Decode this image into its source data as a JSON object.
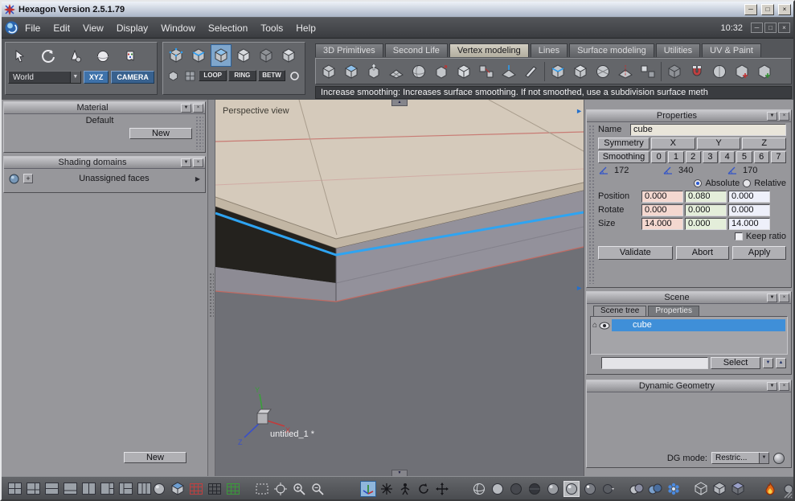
{
  "glyphs": {
    "collapse": "▼",
    "up": "▲",
    "down": "▼",
    "expand": "▶",
    "panel_arrow": "►",
    "close": "×",
    "minimize": "─",
    "maximize": "□",
    "plus": "+",
    "home": "⌂",
    "dropdown": "▼"
  },
  "window": {
    "title": "Hexagon Version 2.5.1.79",
    "clock": "10:32"
  },
  "menu": {
    "items": [
      "File",
      "Edit",
      "View",
      "Display",
      "Window",
      "Selection",
      "Tools",
      "Help"
    ]
  },
  "ribbon": {
    "tabs": [
      "3D Primitives",
      "Second Life",
      "Vertex modeling",
      "Lines",
      "Surface modeling",
      "Utilities",
      "UV & Paint"
    ],
    "active_tab": "Vertex modeling",
    "status": "Increase smoothing: Increases surface smoothing. If not smoothed, use a subdivision surface meth"
  },
  "toolbar": {
    "world": "World",
    "xyz": "XYZ",
    "camera": "CAMERA",
    "loop": "LOOP",
    "ring": "RING",
    "betw": "BETW"
  },
  "left": {
    "material": {
      "title": "Material",
      "item": "Default",
      "new_button": "New"
    },
    "shading": {
      "title": "Shading domains",
      "item": "Unassigned faces"
    },
    "new_button": "New"
  },
  "viewport": {
    "label": "Perspective view",
    "document": "untitled_1 *",
    "axis_x": "X",
    "axis_y": "Y",
    "axis_z": "Z"
  },
  "properties": {
    "title": "Properties",
    "name_label": "Name",
    "name_value": "cube",
    "symmetry": "Symmetry",
    "axes": [
      "X",
      "Y",
      "Z"
    ],
    "smoothing": "Smoothing",
    "levels": [
      "0",
      "1",
      "2",
      "3",
      "4",
      "5",
      "6",
      "7"
    ],
    "angles": [
      "172",
      "340",
      "170"
    ],
    "absolute": "Absolute",
    "relative": "Relative",
    "rows": [
      {
        "label": "Position",
        "x": "0.000",
        "y": "0.080",
        "z": "0.000"
      },
      {
        "label": "Rotate",
        "x": "0.000",
        "y": "0.000",
        "z": "0.000"
      },
      {
        "label": "Size",
        "x": "14.000",
        "y": "0.000",
        "z": "14.000"
      }
    ],
    "keep_ratio": "Keep ratio",
    "validate": "Validate",
    "abort": "Abort",
    "apply": "Apply"
  },
  "scene": {
    "title": "Scene",
    "tabs": [
      "Scene tree",
      "Properties"
    ],
    "item": "cube",
    "select": "Select"
  },
  "dg": {
    "title": "Dynamic Geometry",
    "mode_label": "DG mode:",
    "mode_value": "Restric..."
  },
  "colors": {
    "selection_blue": "#3f8fd8",
    "edge_highlight_blue": "#2ea4f2",
    "tab_active_bg": "#c8c4b6",
    "field_x_bg": "#f4d8d0",
    "field_y_bg": "#e4eeda",
    "field_z_bg": "#eef0fa"
  }
}
